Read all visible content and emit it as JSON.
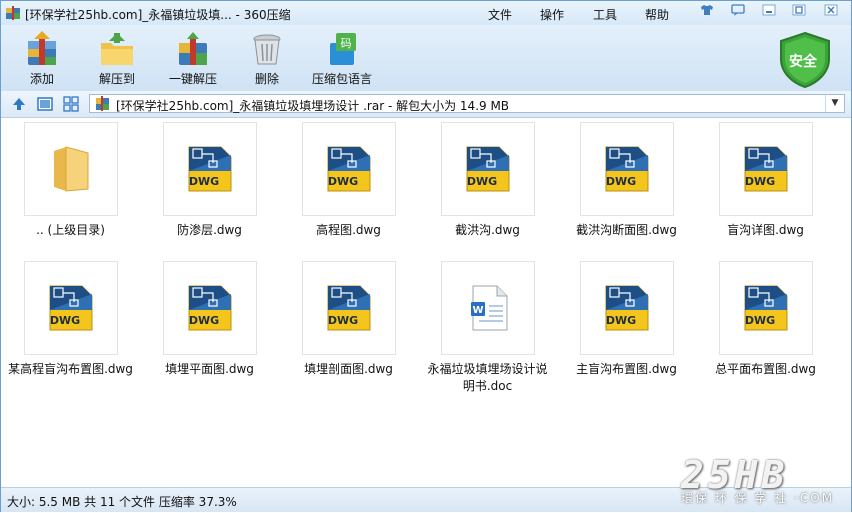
{
  "window": {
    "title": "[环保学社25hb.com]_永福镇垃圾填... - 360压缩",
    "menus": [
      "文件",
      "操作",
      "工具",
      "帮助"
    ],
    "controls": [
      "shirt-icon",
      "feedback-icon",
      "minimize-icon",
      "restore-icon",
      "close-icon"
    ]
  },
  "toolbar": {
    "items": [
      {
        "label": "添加",
        "icon": "add-archive-icon"
      },
      {
        "label": "解压到",
        "icon": "extract-to-icon"
      },
      {
        "label": "一键解压",
        "icon": "one-click-extract-icon"
      },
      {
        "label": "删除",
        "icon": "trash-icon"
      },
      {
        "label": "压缩包语言",
        "icon": "archive-language-icon"
      }
    ],
    "shield_label": "安全"
  },
  "address": {
    "path": "[环保学社25hb.com]_永福镇垃圾填埋场设计 .rar - 解包大小为 14.9 MB"
  },
  "files": [
    {
      "name": ".. (上级目录)",
      "type": "folder"
    },
    {
      "name": "防渗层.dwg",
      "type": "dwg"
    },
    {
      "name": "高程图.dwg",
      "type": "dwg"
    },
    {
      "name": "截洪沟.dwg",
      "type": "dwg"
    },
    {
      "name": "截洪沟断面图.dwg",
      "type": "dwg"
    },
    {
      "name": "盲沟详图.dwg",
      "type": "dwg"
    },
    {
      "name": "某高程盲沟布置图.dwg",
      "type": "dwg"
    },
    {
      "name": "填埋平面图.dwg",
      "type": "dwg"
    },
    {
      "name": "填埋剖面图.dwg",
      "type": "dwg"
    },
    {
      "name": "永福垃圾填埋场设计说明书.doc",
      "type": "doc"
    },
    {
      "name": "主盲沟布置图.dwg",
      "type": "dwg"
    },
    {
      "name": "总平面布置图.dwg",
      "type": "dwg"
    }
  ],
  "dwg_badge": "DWG",
  "status": {
    "text": "大小: 5.5 MB 共 11 个文件 压缩率 37.3%"
  },
  "watermark": {
    "main": "25HB",
    "sub": "環保 环 保 学 社 ·COM"
  }
}
